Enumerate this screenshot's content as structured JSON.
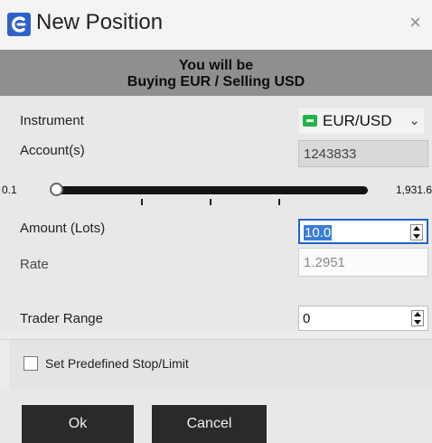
{
  "window": {
    "title": "New Position",
    "close_glyph": "×",
    "icon": "app-logo-icon"
  },
  "banner": {
    "line1": "You will be",
    "line2": "Buying EUR / Selling USD"
  },
  "form": {
    "instrument": {
      "label": "Instrument",
      "value": "EUR/USD",
      "chevron": "⌄",
      "flag_icon": "currency-flag-icon"
    },
    "accounts": {
      "label": "Account(s)",
      "value": "1243833"
    },
    "slider": {
      "min_label": "0.1",
      "max_label": "1,931.6"
    },
    "amount": {
      "label": "Amount (Lots)",
      "value": "10.0"
    },
    "rate": {
      "label": "Rate",
      "value": "1.2951"
    },
    "trader_range": {
      "label": "Trader Range",
      "value": "0"
    },
    "predefined": {
      "label": "Set Predefined Stop/Limit",
      "checked": false
    }
  },
  "buttons": {
    "ok": "Ok",
    "cancel": "Cancel"
  },
  "colors": {
    "banner_bg": "#8f8f8f",
    "button_bg": "#2a2a2a",
    "selection": "#3a7fd6",
    "flag": "#27b24a"
  }
}
